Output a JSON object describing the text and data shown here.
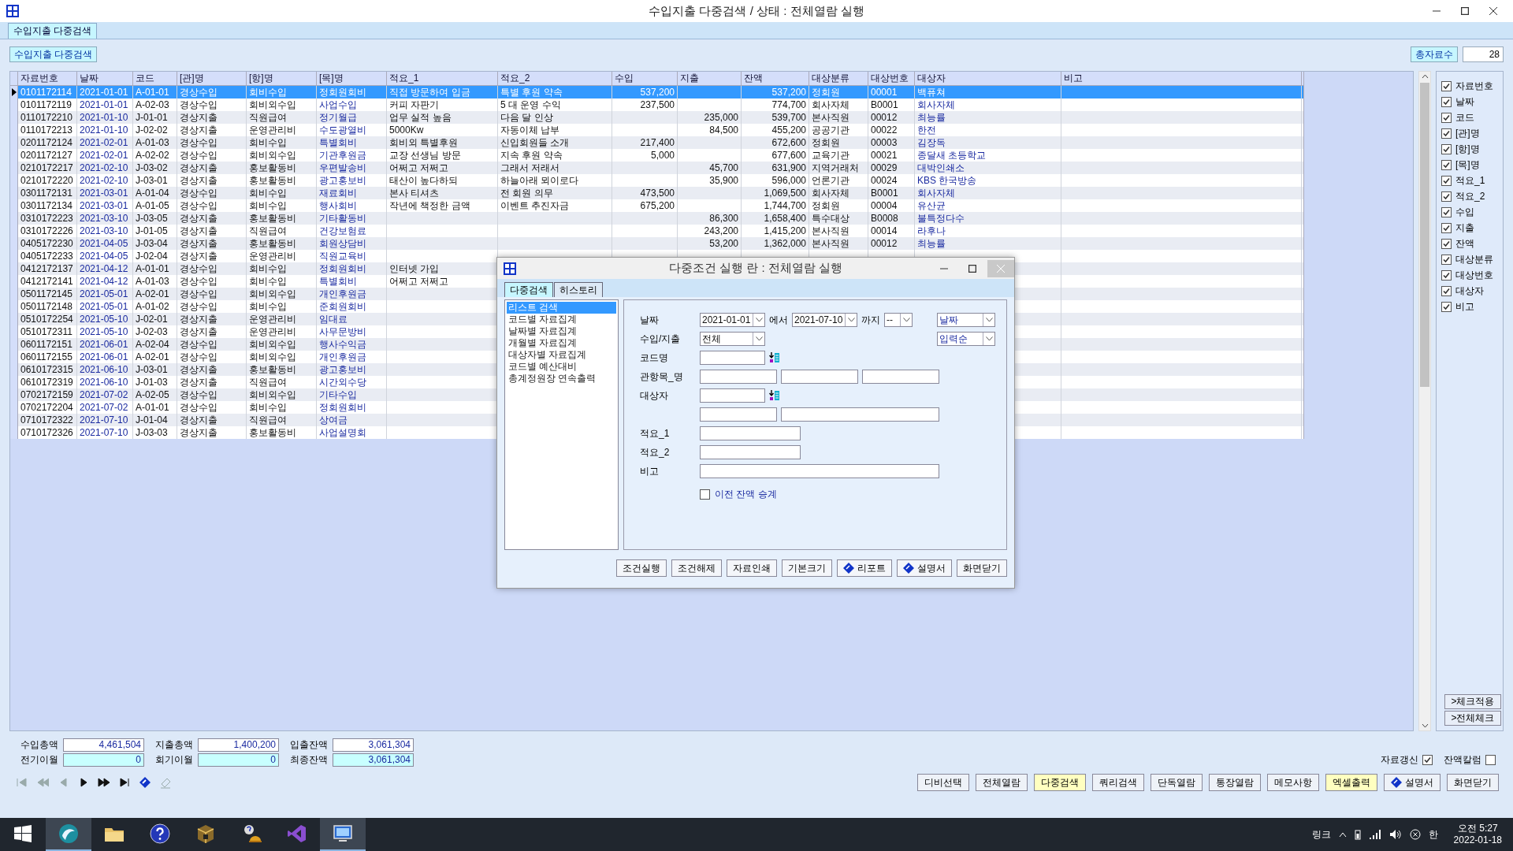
{
  "window": {
    "title": "수입지출 다중검색 / 상태 : 전체열람 실행"
  },
  "tabs": [
    {
      "label": "수입지출 다중검색",
      "selected": true
    }
  ],
  "toolbar": {
    "search_button": "수입지출 다중검색",
    "total_label": "총자료수",
    "total_count": "28"
  },
  "table": {
    "columns": [
      "자료번호",
      "날짜",
      "코드",
      "[관]명",
      "[항]명",
      "[목]명",
      "적요_1",
      "적요_2",
      "수입",
      "지출",
      "잔액",
      "대상분류",
      "대상번호",
      "대상자",
      "비고"
    ],
    "rows": [
      {
        "selected": true,
        "id": "0101172114",
        "date": "2021-01-01",
        "code": "A-01-01",
        "gwan": "경상수입",
        "hang": "회비수입",
        "mok": "정회원회비",
        "memo1": "직접 방문하여 입금",
        "memo2": "특별 후원 약속",
        "income": "537,200",
        "balance": "537,200",
        "target_type": "정회원",
        "target_no": "00001",
        "target": "백퓨쳐"
      },
      {
        "selected": false,
        "id": "0101172119",
        "date": "2021-01-01",
        "code": "A-02-03",
        "gwan": "경상수입",
        "hang": "회비외수입",
        "mok": "사업수입",
        "memo1": "커피 자판기",
        "memo2": "5 대 운영 수익",
        "income": "237,500",
        "balance": "774,700",
        "target_type": "회사자체",
        "target_no": "B0001",
        "target": "회사자체"
      },
      {
        "selected": false,
        "id": "0110172210",
        "date": "2021-01-10",
        "code": "J-01-01",
        "gwan": "경상지출",
        "hang": "직원급여",
        "mok": "정기월급",
        "memo1": "업무 실적 높음",
        "memo2": "다음 달 인상",
        "expense": "235,000",
        "balance": "539,700",
        "target_type": "본사직원",
        "target_no": "00012",
        "target": "최능률"
      },
      {
        "selected": false,
        "id": "0110172213",
        "date": "2021-01-10",
        "code": "J-02-02",
        "gwan": "경상지출",
        "hang": "운영관리비",
        "mok": "수도광열비",
        "memo1": "5000Kw",
        "memo2": "자동이체 납부",
        "expense": "84,500",
        "balance": "455,200",
        "target_type": "공공기관",
        "target_no": "00022",
        "target": "한전"
      },
      {
        "selected": false,
        "id": "0201172124",
        "date": "2021-02-01",
        "code": "A-01-03",
        "gwan": "경상수입",
        "hang": "회비수입",
        "mok": "특별회비",
        "memo1": "회비외 특별후원",
        "memo2": "신입회원들 소개",
        "income": "217,400",
        "balance": "672,600",
        "target_type": "정회원",
        "target_no": "00003",
        "target": "김장독"
      },
      {
        "selected": false,
        "id": "0201172127",
        "date": "2021-02-01",
        "code": "A-02-02",
        "gwan": "경상수입",
        "hang": "회비외수입",
        "mok": "기관후원금",
        "memo1": "교장 선생님 방문",
        "memo2": "지속 후원 약속",
        "income": "5,000",
        "balance": "677,600",
        "target_type": "교육기관",
        "target_no": "00021",
        "target": "종달새 초등학교"
      },
      {
        "selected": false,
        "id": "0210172217",
        "date": "2021-02-10",
        "code": "J-03-02",
        "gwan": "경상지출",
        "hang": "홍보활동비",
        "mok": "우편발송비",
        "memo1": "어쩌고 저쩌고",
        "memo2": "그래서 저래서",
        "expense": "45,700",
        "balance": "631,900",
        "target_type": "지역거래처",
        "target_no": "00029",
        "target": "대박인쇄소"
      },
      {
        "selected": false,
        "id": "0210172220",
        "date": "2021-02-10",
        "code": "J-03-01",
        "gwan": "경상지출",
        "hang": "홍보활동비",
        "mok": "광고홍보비",
        "memo1": "태산이 높다하되",
        "memo2": "하늘아래 뫼이로다",
        "expense": "35,900",
        "balance": "596,000",
        "target_type": "언론기관",
        "target_no": "00024",
        "target": "KBS 한국방송"
      },
      {
        "selected": false,
        "id": "0301172131",
        "date": "2021-03-01",
        "code": "A-01-04",
        "gwan": "경상수입",
        "hang": "회비수입",
        "mok": "재료회비",
        "memo1": "본사 티셔츠",
        "memo2": "전 회원 의무",
        "income": "473,500",
        "balance": "1,069,500",
        "target_type": "회사자체",
        "target_no": "B0001",
        "target": "회사자체"
      },
      {
        "selected": false,
        "id": "0301172134",
        "date": "2021-03-01",
        "code": "A-01-05",
        "gwan": "경상수입",
        "hang": "회비수입",
        "mok": "행사회비",
        "memo1": "작년에 책정한 금액",
        "memo2": "이벤트 추진자금",
        "income": "675,200",
        "balance": "1,744,700",
        "target_type": "정회원",
        "target_no": "00004",
        "target": "유산균"
      },
      {
        "selected": false,
        "id": "0310172223",
        "date": "2021-03-10",
        "code": "J-03-05",
        "gwan": "경상지출",
        "hang": "홍보활동비",
        "mok": "기타활동비",
        "expense": "86,300",
        "balance": "1,658,400",
        "target_type": "특수대상",
        "target_no": "B0008",
        "target": "불특정다수"
      },
      {
        "selected": false,
        "id": "0310172226",
        "date": "2021-03-10",
        "code": "J-01-05",
        "gwan": "경상지출",
        "hang": "직원급여",
        "mok": "건강보험료",
        "expense": "243,200",
        "balance": "1,415,200",
        "target_type": "본사직원",
        "target_no": "00014",
        "target": "라후나"
      },
      {
        "selected": false,
        "id": "0405172230",
        "date": "2021-04-05",
        "code": "J-03-04",
        "gwan": "경상지출",
        "hang": "홍보활동비",
        "mok": "회원상담비",
        "expense": "53,200",
        "balance": "1,362,000",
        "target_type": "본사직원",
        "target_no": "00012",
        "target": "최능률"
      },
      {
        "selected": false,
        "id": "0405172233",
        "date": "2021-04-05",
        "code": "J-02-04",
        "gwan": "경상지출",
        "hang": "운영관리비",
        "mok": "직원교육비"
      },
      {
        "selected": false,
        "id": "0412172137",
        "date": "2021-04-12",
        "code": "A-01-01",
        "gwan": "경상수입",
        "hang": "회비수입",
        "mok": "정회원회비",
        "memo1": "인터넷 가입"
      },
      {
        "selected": false,
        "id": "0412172141",
        "date": "2021-04-12",
        "code": "A-01-03",
        "gwan": "경상수입",
        "hang": "회비수입",
        "mok": "특별회비",
        "memo1": "어쩌고 저쩌고"
      },
      {
        "selected": false,
        "id": "0501172145",
        "date": "2021-05-01",
        "code": "A-02-01",
        "gwan": "경상수입",
        "hang": "회비외수입",
        "mok": "개인후원금"
      },
      {
        "selected": false,
        "id": "0501172148",
        "date": "2021-05-01",
        "code": "A-01-02",
        "gwan": "경상수입",
        "hang": "회비수입",
        "mok": "준회원회비"
      },
      {
        "selected": false,
        "id": "0510172254",
        "date": "2021-05-10",
        "code": "J-02-01",
        "gwan": "경상지출",
        "hang": "운영관리비",
        "mok": "임대료"
      },
      {
        "selected": false,
        "id": "0510172311",
        "date": "2021-05-10",
        "code": "J-02-03",
        "gwan": "경상지출",
        "hang": "운영관리비",
        "mok": "사무문방비"
      },
      {
        "selected": false,
        "id": "0601172151",
        "date": "2021-06-01",
        "code": "A-02-04",
        "gwan": "경상수입",
        "hang": "회비외수입",
        "mok": "행사수익금"
      },
      {
        "selected": false,
        "id": "0601172155",
        "date": "2021-06-01",
        "code": "A-02-01",
        "gwan": "경상수입",
        "hang": "회비외수입",
        "mok": "개인후원금"
      },
      {
        "selected": false,
        "id": "0610172315",
        "date": "2021-06-10",
        "code": "J-03-01",
        "gwan": "경상지출",
        "hang": "홍보활동비",
        "mok": "광고홍보비"
      },
      {
        "selected": false,
        "id": "0610172319",
        "date": "2021-06-10",
        "code": "J-01-03",
        "gwan": "경상지출",
        "hang": "직원급여",
        "mok": "시간외수당"
      },
      {
        "selected": false,
        "id": "0702172159",
        "date": "2021-07-02",
        "code": "A-02-05",
        "gwan": "경상수입",
        "hang": "회비외수입",
        "mok": "기타수입"
      },
      {
        "selected": false,
        "id": "0702172204",
        "date": "2021-07-02",
        "code": "A-01-01",
        "gwan": "경상수입",
        "hang": "회비수입",
        "mok": "정회원회비"
      },
      {
        "selected": false,
        "id": "0710172322",
        "date": "2021-07-10",
        "code": "J-01-04",
        "gwan": "경상지출",
        "hang": "직원급여",
        "mok": "상여금"
      },
      {
        "selected": false,
        "id": "0710172326",
        "date": "2021-07-10",
        "code": "J-03-03",
        "gwan": "경상지출",
        "hang": "홍보활동비",
        "mok": "사업설명회"
      }
    ]
  },
  "column_checks": [
    {
      "label": "자료번호",
      "checked": true
    },
    {
      "label": "날짜",
      "checked": true
    },
    {
      "label": "코드",
      "checked": true
    },
    {
      "label": "[관]명",
      "checked": true
    },
    {
      "label": "[항]명",
      "checked": true
    },
    {
      "label": "[목]명",
      "checked": true
    },
    {
      "label": "적요_1",
      "checked": true
    },
    {
      "label": "적요_2",
      "checked": true
    },
    {
      "label": "수입",
      "checked": true
    },
    {
      "label": "지출",
      "checked": true
    },
    {
      "label": "잔액",
      "checked": true
    },
    {
      "label": "대상분류",
      "checked": true
    },
    {
      "label": "대상번호",
      "checked": true
    },
    {
      "label": "대상자",
      "checked": true
    },
    {
      "label": "비고",
      "checked": true
    }
  ],
  "column_buttons": [
    ">체크적용",
    ">전체체크"
  ],
  "summary": [
    {
      "label": "수입총액",
      "value": "4,461,504",
      "highlight": false
    },
    {
      "label": "지출총액",
      "value": "1,400,200",
      "highlight": false
    },
    {
      "label": "입출잔액",
      "value": "3,061,304",
      "highlight": false
    },
    {
      "label": "전기이월",
      "value": "0",
      "highlight": true
    },
    {
      "label": "회기이월",
      "value": "0",
      "highlight": true
    },
    {
      "label": "최종잔액",
      "value": "3,061,304",
      "highlight": true
    }
  ],
  "options": [
    {
      "label": "자료갱신",
      "checked": true
    },
    {
      "label": "잔액칼럼",
      "checked": false
    }
  ],
  "navigator": [
    {
      "kind": "first",
      "disabled": true
    },
    {
      "kind": "prev-page",
      "disabled": true
    },
    {
      "kind": "prev",
      "disabled": true
    },
    {
      "kind": "next",
      "disabled": false
    },
    {
      "kind": "next-page",
      "disabled": false
    },
    {
      "kind": "last",
      "disabled": false
    },
    {
      "kind": "edit",
      "disabled": false
    },
    {
      "kind": "erase",
      "disabled": true
    }
  ],
  "actions": [
    {
      "label": "디비선택",
      "highlighted": false,
      "icon": false
    },
    {
      "label": "전체열람",
      "highlighted": false,
      "icon": false
    },
    {
      "label": "다중검색",
      "highlighted": true,
      "icon": false
    },
    {
      "label": "쿼리검색",
      "highlighted": false,
      "icon": false
    },
    {
      "label": "단독열람",
      "highlighted": false,
      "icon": false
    },
    {
      "label": "통장열람",
      "highlighted": false,
      "icon": false
    },
    {
      "label": "메모사항",
      "highlighted": false,
      "icon": false
    },
    {
      "label": "엑셀출력",
      "highlighted": true,
      "icon": false
    },
    {
      "label": "설명서",
      "highlighted": false,
      "icon": true
    },
    {
      "label": "화면닫기",
      "highlighted": false,
      "icon": false
    }
  ],
  "dialog": {
    "title": "다중조건 실행 란 : 전체열람 실행",
    "tabs": [
      {
        "label": "다중검색",
        "selected": true
      },
      {
        "label": "히스토리",
        "selected": false
      }
    ],
    "modes": [
      {
        "label": "리스트 검색",
        "selected": true
      },
      {
        "label": "코드별 자료집계",
        "selected": false
      },
      {
        "label": "날짜별 자료집계",
        "selected": false
      },
      {
        "label": "개월별 자료집계",
        "selected": false
      },
      {
        "label": "대상자별 자료집계",
        "selected": false
      },
      {
        "label": "코드별 예산대비",
        "selected": false
      },
      {
        "label": "총계정원장 연속출력",
        "selected": false
      }
    ],
    "form": {
      "date_label": "날짜",
      "date_from": "2021-01-01",
      "from_suffix": "에서",
      "date_to": "2021-07-10",
      "to_suffix": "까지",
      "date_extra": "--",
      "sort_field": "날짜",
      "sort_order": "입력순",
      "type_label": "수입/지출",
      "type_value": "전체",
      "code_label": "코드명",
      "account_label": "관항목_명",
      "target_label": "대상자",
      "memo1_label": "적요_1",
      "memo2_label": "적요_2",
      "note_label": "비고",
      "carry": {
        "label": "이전 잔액 승계",
        "checked": false
      }
    },
    "buttons": [
      {
        "label": "조건실행",
        "icon": false
      },
      {
        "label": "조건해제",
        "icon": false
      },
      {
        "label": "자료인쇄",
        "icon": false
      },
      {
        "label": "기본크기",
        "icon": false
      },
      {
        "label": "리포트",
        "icon": true
      },
      {
        "label": "설명서",
        "icon": true
      },
      {
        "label": "화면닫기",
        "icon": false
      }
    ]
  },
  "taskbar": {
    "apps": [
      {
        "kind": "swirl",
        "active": true
      },
      {
        "kind": "folder",
        "active": false
      },
      {
        "kind": "help",
        "active": false
      },
      {
        "kind": "box",
        "active": false
      },
      {
        "kind": "bell",
        "active": false
      },
      {
        "kind": "ribbon",
        "active": false
      },
      {
        "kind": "monitor",
        "active": true
      }
    ],
    "link": "링크",
    "ime": "한",
    "time": "오전 5:27",
    "date": "2022-01-18"
  }
}
